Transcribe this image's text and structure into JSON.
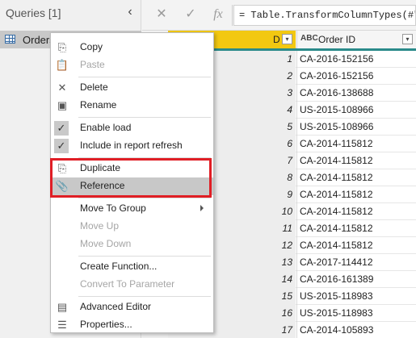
{
  "queries_pane": {
    "header": "Queries [1]",
    "collapse_glyph": "‹",
    "query_name": "Orders"
  },
  "formula_bar": {
    "cancel_glyph": "✕",
    "commit_glyph": "✓",
    "fx_glyph": "fx",
    "formula": "= Table.TransformColumnTypes(#\"Pr"
  },
  "grid": {
    "selected_col_header": "D",
    "order_col_type_glyph": "ABC",
    "order_col_header": "Order ID",
    "dropdown_glyph": "▾",
    "rows": [
      {
        "row_id": "1",
        "order_id": "CA-2016-152156"
      },
      {
        "row_id": "2",
        "order_id": "CA-2016-152156"
      },
      {
        "row_id": "3",
        "order_id": "CA-2016-138688"
      },
      {
        "row_id": "4",
        "order_id": "US-2015-108966"
      },
      {
        "row_id": "5",
        "order_id": "US-2015-108966"
      },
      {
        "row_id": "6",
        "order_id": "CA-2014-115812"
      },
      {
        "row_id": "7",
        "order_id": "CA-2014-115812"
      },
      {
        "row_id": "8",
        "order_id": "CA-2014-115812"
      },
      {
        "row_id": "9",
        "order_id": "CA-2014-115812"
      },
      {
        "row_id": "10",
        "order_id": "CA-2014-115812"
      },
      {
        "row_id": "11",
        "order_id": "CA-2014-115812"
      },
      {
        "row_id": "12",
        "order_id": "CA-2014-115812"
      },
      {
        "row_id": "13",
        "order_id": "CA-2017-114412"
      },
      {
        "row_id": "14",
        "order_id": "CA-2016-161389"
      },
      {
        "row_id": "15",
        "order_id": "US-2015-118983"
      },
      {
        "row_id": "16",
        "order_id": "US-2015-118983"
      },
      {
        "row_id": "17",
        "order_id": "CA-2014-105893"
      }
    ]
  },
  "context_menu": {
    "copy": "Copy",
    "paste": "Paste",
    "delete": "Delete",
    "rename": "Rename",
    "enable_load": "Enable load",
    "include_refresh": "Include in report refresh",
    "duplicate": "Duplicate",
    "reference": "Reference",
    "move_to_group": "Move To Group",
    "move_up": "Move Up",
    "move_down": "Move Down",
    "create_function": "Create Function...",
    "convert_to_parameter": "Convert To Parameter",
    "advanced_editor": "Advanced Editor",
    "properties": "Properties..."
  },
  "icons": {
    "copy": "copy-icon",
    "paste": "paste-icon",
    "delete": "delete-icon",
    "rename": "rename-icon",
    "checkmark": "checkmark-icon",
    "duplicate": "duplicate-icon",
    "reference": "paperclip-icon",
    "advanced_editor": "advanced-editor-icon",
    "properties": "properties-icon"
  },
  "colors": {
    "selected_column": "#f2c811",
    "highlight_box": "#e01e25",
    "menu_highlight": "#c8c8c8"
  }
}
